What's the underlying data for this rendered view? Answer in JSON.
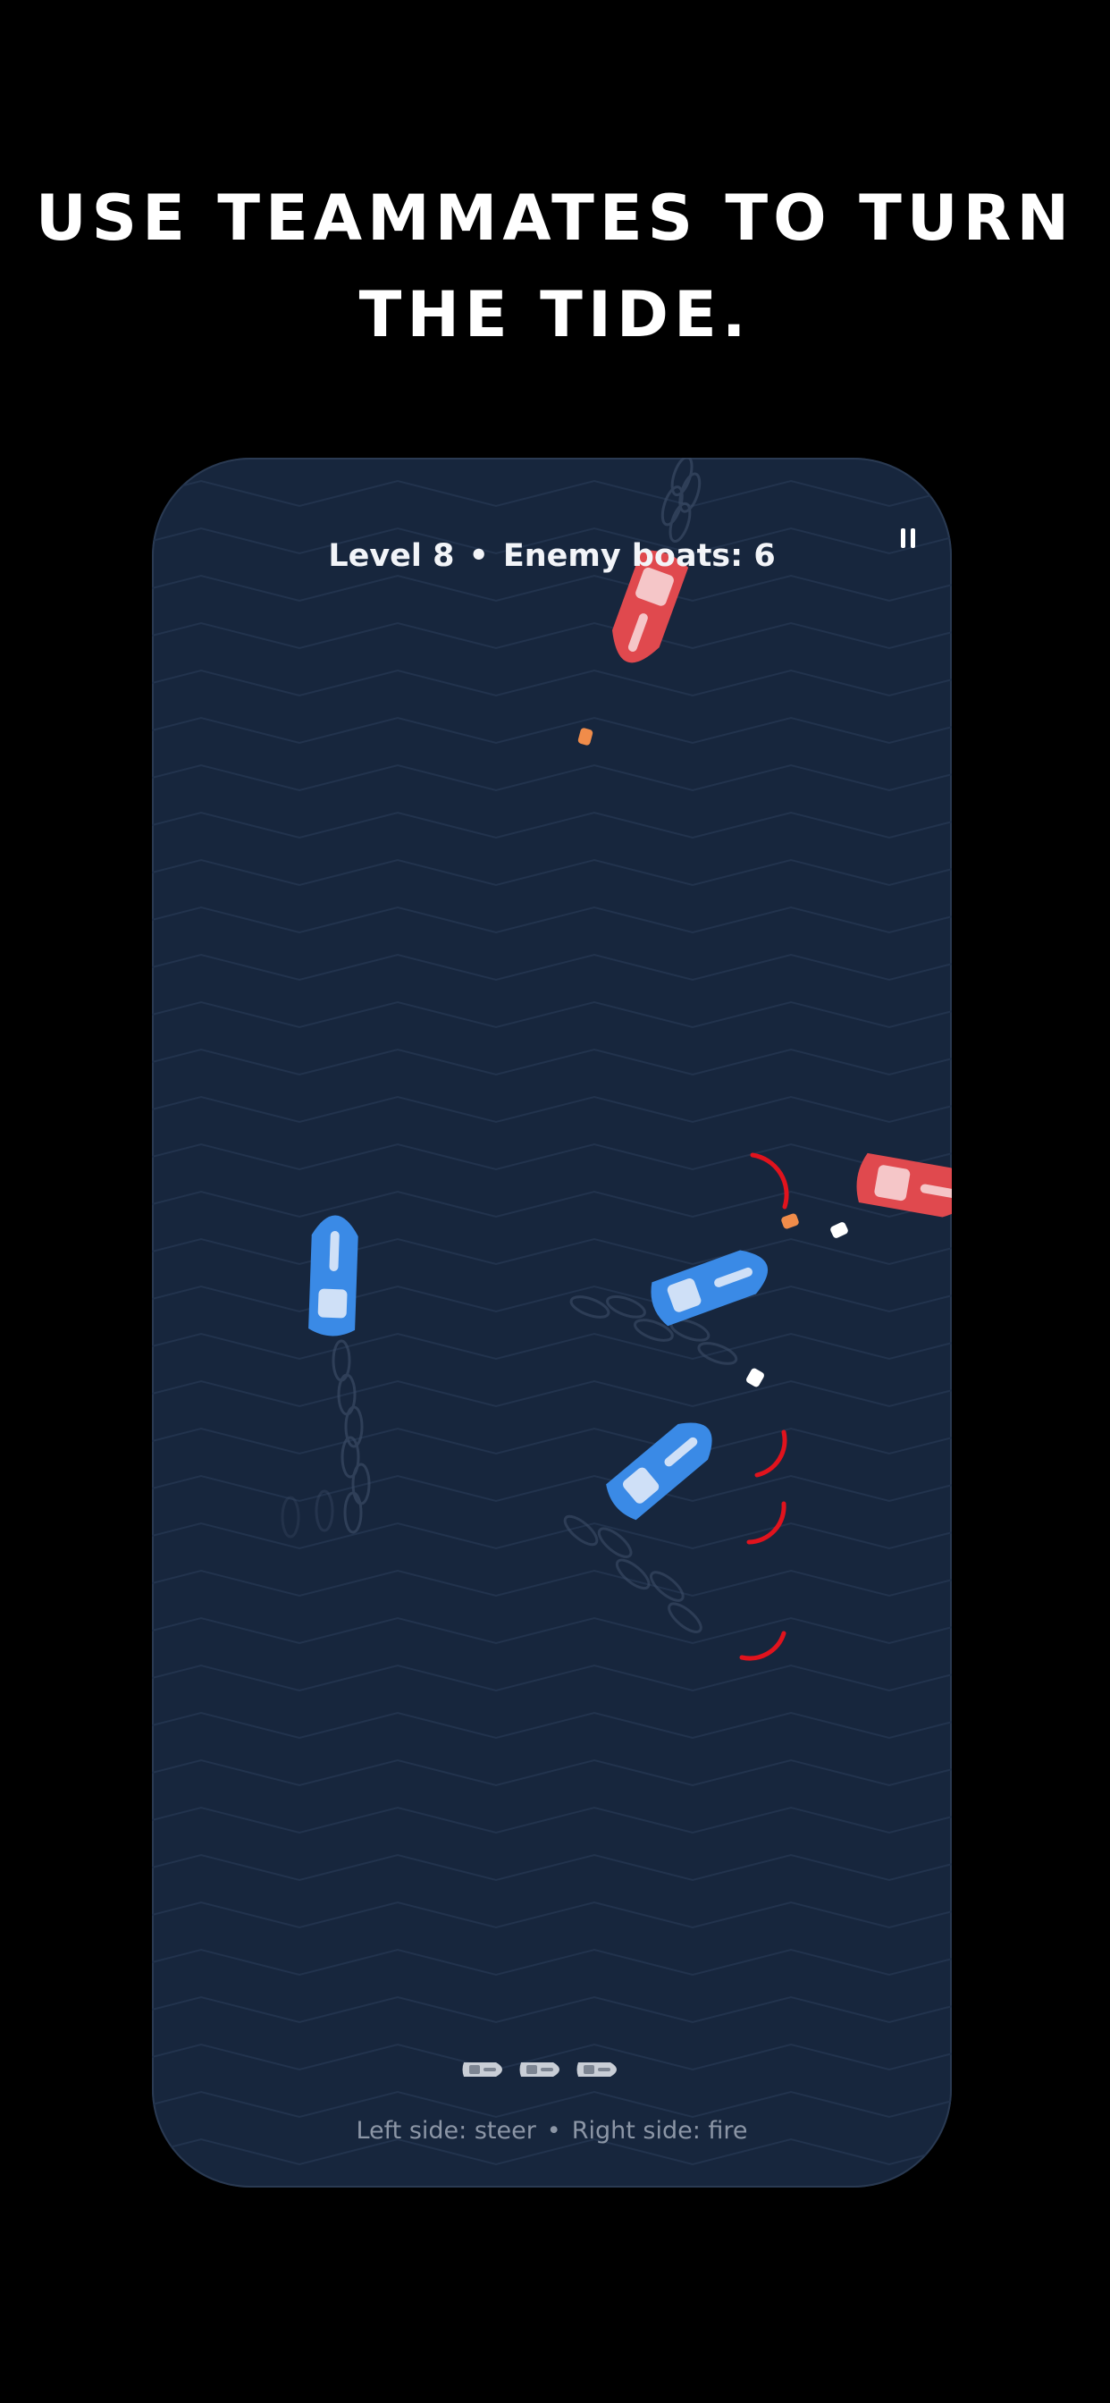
{
  "banner": {
    "line1": "USE TEAMMATES TO TURN",
    "line2": "THE TIDE."
  },
  "hud": {
    "level_label": "Level 8",
    "separator": "•",
    "enemies_label": "Enemy boats: 6",
    "pause_icon": "pause-icon"
  },
  "game": {
    "lives_remaining": 3,
    "player_boats": 3,
    "enemy_boats_visible": 2
  },
  "controls_hint": {
    "left": "Left side: steer",
    "separator": "•",
    "right": "Right side: fire"
  },
  "colors": {
    "background": "#000000",
    "water": "#17263d",
    "wave_line": "#22334d",
    "player_boat": "#3a8ae6",
    "enemy_boat": "#e0494e",
    "player_shot": "#ffffff",
    "enemy_shot": "#f08c4a",
    "sonar_arc": "#e1131d",
    "hud_text": "#f2f4f8",
    "hint_text": "#8c96a6"
  }
}
